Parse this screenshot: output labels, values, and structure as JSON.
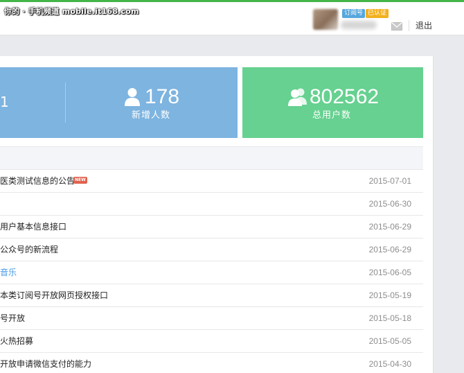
{
  "watermark": "你的 · 手机频道 mobile.it168.com",
  "header": {
    "account_type_badge": "订阅号",
    "verified_badge": "已认证",
    "logout_label": "退出"
  },
  "stats": {
    "fragment_left": "1",
    "new_followers": {
      "value": "178",
      "label": "新增人数"
    },
    "total_users": {
      "value": "802562",
      "label": "总用户数"
    }
  },
  "notices": [
    {
      "title": "医类测试信息的公告",
      "date": "2015-07-01",
      "badge": "NEW",
      "link": false
    },
    {
      "title": "",
      "date": "2015-06-30",
      "link": false
    },
    {
      "title": "用户基本信息接口",
      "date": "2015-06-29",
      "link": false
    },
    {
      "title": "公众号的新流程",
      "date": "2015-06-29",
      "link": false
    },
    {
      "title": "音乐",
      "date": "2015-06-05",
      "link": true
    },
    {
      "title": "本类订阅号开放网页授权接口",
      "date": "2015-05-19",
      "link": false
    },
    {
      "title": "号开放",
      "date": "2015-05-18",
      "link": false
    },
    {
      "title": "火热招募",
      "date": "2015-05-05",
      "link": false
    },
    {
      "title": "开放申请微信支付的能力",
      "date": "2015-04-30",
      "link": false
    }
  ],
  "colors": {
    "accent_green": "#44b549",
    "stat_blue": "#7db4e0",
    "stat_green": "#66d190",
    "link_blue": "#459ae9",
    "new_badge": "#e0624f"
  },
  "icons": [
    "user-icon",
    "users-icon",
    "mail-icon"
  ]
}
